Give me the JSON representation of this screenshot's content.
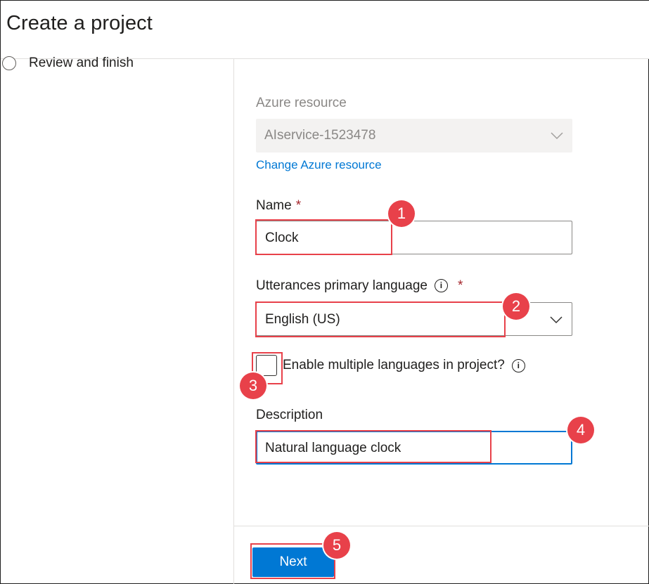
{
  "header": {
    "title": "Create a project"
  },
  "steps": [
    {
      "label": "Review and finish"
    }
  ],
  "form": {
    "azure_resource": {
      "label": "Azure resource",
      "value": "AIservice-1523478",
      "change_link": "Change Azure resource"
    },
    "name": {
      "label": "Name",
      "required_mark": "*",
      "value": "Clock"
    },
    "language": {
      "label": "Utterances primary language",
      "required_mark": "*",
      "value": "English (US)",
      "info_icon": "i"
    },
    "multi_language": {
      "label": "Enable multiple languages in project?",
      "checked": false,
      "info_icon": "i"
    },
    "description": {
      "label": "Description",
      "value": "Natural language clock"
    }
  },
  "footer": {
    "next_label": "Next"
  },
  "annotations": {
    "badges": [
      "1",
      "2",
      "3",
      "4",
      "5"
    ],
    "color": "#e8414a"
  },
  "colors": {
    "accent": "#0078d4",
    "required": "#a4262c",
    "annotation": "#e8414a"
  }
}
